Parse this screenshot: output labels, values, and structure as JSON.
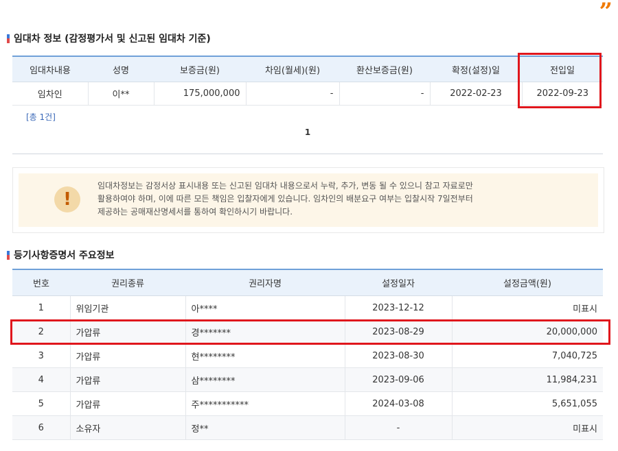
{
  "decoration": {
    "quote_mark": "”"
  },
  "lease_section": {
    "title": "임대차 정보 (감정평가서 및 신고된 임대차 기준)",
    "headers": [
      "임대차내용",
      "성명",
      "보증금(원)",
      "차임(월세)(원)",
      "환산보증금(원)",
      "확정(설정)일",
      "전입일"
    ],
    "rows": [
      [
        "임차인",
        "이**",
        "175,000,000",
        "-",
        "-",
        "2022-02-23",
        "2022-09-23"
      ]
    ],
    "total_count": "[총 1건]",
    "page": "1"
  },
  "notice": {
    "icon": "warning-icon",
    "symbol": "!",
    "lines": [
      "임대차정보는 감정서상 표시내용 또는 신고된 임대차 내용으로서 누락, 추가, 변동 될 수 있으니 참고 자료로만",
      "활용하여야 하며, 이에 따른 모든 책임은 입찰자에게 있습니다. 임차인의 배분요구 여부는 입찰시작 7일전부터",
      "제공하는 공매재산명세서를 통하여 확인하시기 바랍니다."
    ]
  },
  "registry_section": {
    "title": "등기사항증명서 주요정보",
    "headers": [
      "번호",
      "권리종류",
      "권리자명",
      "설정일자",
      "설정금액(원)"
    ],
    "rows": [
      [
        "1",
        "위임기관",
        "아****",
        "2023-12-12",
        "미표시"
      ],
      [
        "2",
        "가압류",
        "경*******",
        "2023-08-29",
        "20,000,000"
      ],
      [
        "3",
        "가압류",
        "현********",
        "2023-08-30",
        "7,040,725"
      ],
      [
        "4",
        "가압류",
        "삼********",
        "2023-09-06",
        "11,984,231"
      ],
      [
        "5",
        "가압류",
        "주***********",
        "2024-03-08",
        "5,651,055"
      ],
      [
        "6",
        "소유자",
        "정**",
        "-",
        "미표시"
      ]
    ]
  },
  "colors": {
    "highlight": "#e0161c",
    "header_bg": "#eaf2fb",
    "header_border": "#6fa0d8",
    "notice_bg": "#fdf6e8"
  }
}
